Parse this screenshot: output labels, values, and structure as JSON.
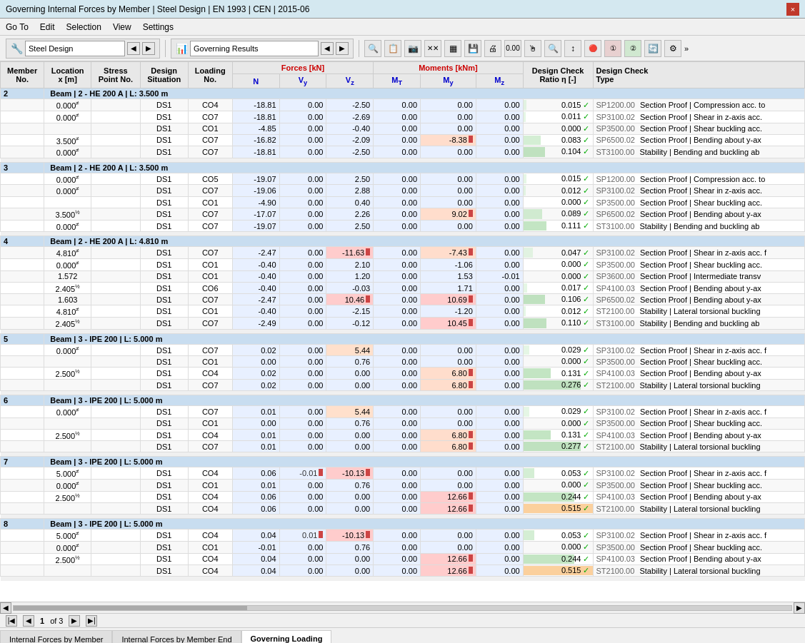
{
  "titleBar": {
    "title": "Governing Internal Forces by Member | Steel Design | EN 1993 | CEN | 2015-06",
    "closeLabel": "×"
  },
  "menuBar": {
    "items": [
      "Go To",
      "Edit",
      "Selection",
      "View",
      "Settings"
    ]
  },
  "toolbar": {
    "leftSection": {
      "icon": "🔧",
      "label": "Steel Design",
      "navPrev": "◀",
      "navNext": "▶"
    },
    "rightSection": {
      "icon": "📊",
      "label": "Governing Results",
      "navPrev": "◀",
      "navNext": "▶"
    },
    "icons": [
      "🔍",
      "📋",
      "📷",
      "✕✕",
      "▦",
      "💾",
      "🖨",
      "0.00",
      "🖱",
      "🔍",
      "↕",
      "🔴🔵",
      "①",
      "②",
      "🔄",
      "⚙"
    ]
  },
  "tableHeaders": {
    "row1": [
      "Member No.",
      "Location x [m]",
      "Stress Point No.",
      "Design Situation",
      "Loading No.",
      "Forces [kN]",
      "",
      "",
      "Moments [kNm]",
      "",
      "",
      "Design Check Ratio η [-]",
      "Design Check Type"
    ],
    "row2": [
      "",
      "",
      "",
      "",
      "",
      "N",
      "Vy",
      "Vz",
      "MT",
      "My",
      "Mz",
      "",
      ""
    ]
  },
  "members": [
    {
      "id": 2,
      "description": "Beam | 2 - HE 200 A | L: 3.500 m",
      "rows": [
        {
          "location": "0.000",
          "stressPoint": "≠",
          "situation": "DS1",
          "loading": "CO4",
          "N": "-18.81",
          "Vy": "0.00",
          "Vz": "-2.50",
          "MT": "0.00",
          "My": "0.00",
          "Mz": "0.00",
          "ratio": "0.015",
          "ratioCheck": "✓",
          "spCode": "SP1200.00",
          "designCheck": "Section Proof | Compression acc. to"
        },
        {
          "location": "0.000",
          "stressPoint": "≠",
          "situation": "DS1",
          "loading": "CO7",
          "N": "-18.81",
          "Vy": "0.00",
          "Vz": "-2.69",
          "MT": "0.00",
          "My": "0.00",
          "Mz": "0.00",
          "ratio": "0.011",
          "ratioCheck": "✓",
          "spCode": "SP3100.02",
          "designCheck": "Section Proof | Shear in z-axis acc."
        },
        {
          "location": "",
          "stressPoint": "",
          "situation": "DS1",
          "loading": "CO1",
          "N": "-4.85",
          "Vy": "0.00",
          "Vz": "-0.40",
          "MT": "0.00",
          "My": "0.00",
          "Mz": "0.00",
          "ratio": "0.000",
          "ratioCheck": "✓",
          "spCode": "SP3500.00",
          "designCheck": "Section Proof | Shear buckling acc."
        },
        {
          "location": "3.500",
          "stressPoint": "≠",
          "situation": "DS1",
          "loading": "CO7",
          "N": "-16.82",
          "Vy": "0.00",
          "Vz": "-2.09",
          "MT": "0.00",
          "My": "-8.38",
          "Mz": "0.00",
          "ratio": "0.083",
          "ratioCheck": "✓",
          "spCode": "SP6500.02",
          "designCheck": "Section Proof | Bending about y-ax"
        },
        {
          "location": "0.000",
          "stressPoint": "≠",
          "situation": "DS1",
          "loading": "CO7",
          "N": "-18.81",
          "Vy": "0.00",
          "Vz": "-2.50",
          "MT": "0.00",
          "My": "0.00",
          "Mz": "0.00",
          "ratio": "0.104",
          "ratioCheck": "✓",
          "spCode": "ST3100.00",
          "designCheck": "Stability | Bending and buckling ab"
        }
      ]
    },
    {
      "id": 3,
      "description": "Beam | 2 - HE 200 A | L: 3.500 m",
      "rows": [
        {
          "location": "0.000",
          "stressPoint": "≠",
          "situation": "DS1",
          "loading": "CO5",
          "N": "-19.07",
          "Vy": "0.00",
          "Vz": "2.50",
          "MT": "0.00",
          "My": "0.00",
          "Mz": "0.00",
          "ratio": "0.015",
          "ratioCheck": "✓",
          "spCode": "SP1200.00",
          "designCheck": "Section Proof | Compression acc. to"
        },
        {
          "location": "0.000",
          "stressPoint": "≠",
          "situation": "DS1",
          "loading": "CO7",
          "N": "-19.06",
          "Vy": "0.00",
          "Vz": "2.88",
          "MT": "0.00",
          "My": "0.00",
          "Mz": "0.00",
          "ratio": "0.012",
          "ratioCheck": "✓",
          "spCode": "SP3100.02",
          "designCheck": "Section Proof | Shear in z-axis acc."
        },
        {
          "location": "",
          "stressPoint": "",
          "situation": "DS1",
          "loading": "CO1",
          "N": "-4.90",
          "Vy": "0.00",
          "Vz": "0.40",
          "MT": "0.00",
          "My": "0.00",
          "Mz": "0.00",
          "ratio": "0.000",
          "ratioCheck": "✓",
          "spCode": "SP3500.00",
          "designCheck": "Section Proof | Shear buckling acc."
        },
        {
          "location": "3.500",
          "stressPoint": "½",
          "situation": "DS1",
          "loading": "CO7",
          "N": "-17.07",
          "Vy": "0.00",
          "Vz": "2.26",
          "MT": "0.00",
          "My": "9.02",
          "Mz": "0.00",
          "ratio": "0.089",
          "ratioCheck": "✓",
          "spCode": "SP6500.02",
          "designCheck": "Section Proof | Bending about y-ax"
        },
        {
          "location": "0.000",
          "stressPoint": "≠",
          "situation": "DS1",
          "loading": "CO7",
          "N": "-19.07",
          "Vy": "0.00",
          "Vz": "2.50",
          "MT": "0.00",
          "My": "0.00",
          "Mz": "0.00",
          "ratio": "0.111",
          "ratioCheck": "✓",
          "spCode": "ST3100.00",
          "designCheck": "Stability | Bending and buckling ab"
        }
      ]
    },
    {
      "id": 4,
      "description": "Beam | 2 - HE 200 A | L: 4.810 m",
      "rows": [
        {
          "location": "4.810",
          "stressPoint": "≠",
          "situation": "DS1",
          "loading": "CO7",
          "N": "-2.47",
          "Vy": "0.00",
          "Vz": "-11.63",
          "MT": "0.00",
          "My": "-7.43",
          "Mz": "0.00",
          "ratio": "0.047",
          "ratioCheck": "✓",
          "spCode": "SP3100.02",
          "designCheck": "Section Proof | Shear in z-axis acc. f"
        },
        {
          "location": "0.000",
          "stressPoint": "≠",
          "situation": "DS1",
          "loading": "CO1",
          "N": "-0.40",
          "Vy": "0.00",
          "Vz": "2.10",
          "MT": "0.00",
          "My": "-1.06",
          "Mz": "0.00",
          "ratio": "0.000",
          "ratioCheck": "✓",
          "spCode": "SP3500.00",
          "designCheck": "Section Proof | Shear buckling acc."
        },
        {
          "location": "1.572",
          "stressPoint": "",
          "situation": "DS1",
          "loading": "CO1",
          "N": "-0.40",
          "Vy": "0.00",
          "Vz": "1.20",
          "MT": "0.00",
          "My": "1.53",
          "Mz": "-0.01",
          "ratio": "0.000",
          "ratioCheck": "✓",
          "spCode": "SP3600.00",
          "designCheck": "Section Proof | Intermediate transv"
        },
        {
          "location": "2.405",
          "stressPoint": "½",
          "situation": "DS1",
          "loading": "CO6",
          "N": "-0.40",
          "Vy": "0.00",
          "Vz": "-0.03",
          "MT": "0.00",
          "My": "1.71",
          "Mz": "0.00",
          "ratio": "0.017",
          "ratioCheck": "✓",
          "spCode": "SP4100.03",
          "designCheck": "Section Proof | Bending about y-ax"
        },
        {
          "location": "1.603",
          "stressPoint": "",
          "situation": "DS1",
          "loading": "CO7",
          "N": "-2.47",
          "Vy": "0.00",
          "Vz": "10.46",
          "MT": "0.00",
          "My": "10.69",
          "Mz": "0.00",
          "ratio": "0.106",
          "ratioCheck": "✓",
          "spCode": "SP6500.02",
          "designCheck": "Section Proof | Bending about y-ax"
        },
        {
          "location": "4.810",
          "stressPoint": "≠",
          "situation": "DS1",
          "loading": "CO1",
          "N": "-0.40",
          "Vy": "0.00",
          "Vz": "-2.15",
          "MT": "0.00",
          "My": "-1.20",
          "Mz": "0.00",
          "ratio": "0.012",
          "ratioCheck": "✓",
          "spCode": "ST2100.00",
          "designCheck": "Stability | Lateral torsional buckling"
        },
        {
          "location": "2.405",
          "stressPoint": "½",
          "situation": "DS1",
          "loading": "CO7",
          "N": "-2.49",
          "Vy": "0.00",
          "Vz": "-0.12",
          "MT": "0.00",
          "My": "10.45",
          "Mz": "0.00",
          "ratio": "0.110",
          "ratioCheck": "✓",
          "spCode": "ST3100.00",
          "designCheck": "Stability | Bending and buckling ab"
        }
      ]
    },
    {
      "id": 5,
      "description": "Beam | 3 - IPE 200 | L: 5.000 m",
      "rows": [
        {
          "location": "0.000",
          "stressPoint": "≠",
          "situation": "DS1",
          "loading": "CO7",
          "N": "0.02",
          "Vy": "0.00",
          "Vz": "5.44",
          "MT": "0.00",
          "My": "0.00",
          "Mz": "0.00",
          "ratio": "0.029",
          "ratioCheck": "✓",
          "spCode": "SP3100.02",
          "designCheck": "Section Proof | Shear in z-axis acc. f"
        },
        {
          "location": "",
          "stressPoint": "",
          "situation": "DS1",
          "loading": "CO1",
          "N": "0.00",
          "Vy": "0.00",
          "Vz": "0.76",
          "MT": "0.00",
          "My": "0.00",
          "Mz": "0.00",
          "ratio": "0.000",
          "ratioCheck": "✓",
          "spCode": "SP3500.00",
          "designCheck": "Section Proof | Shear buckling acc."
        },
        {
          "location": "2.500",
          "stressPoint": "½",
          "situation": "DS1",
          "loading": "CO4",
          "N": "0.02",
          "Vy": "0.00",
          "Vz": "0.00",
          "MT": "0.00",
          "My": "6.80",
          "Mz": "0.00",
          "ratio": "0.131",
          "ratioCheck": "✓",
          "spCode": "SP4100.03",
          "designCheck": "Section Proof | Bending about y-ax"
        },
        {
          "location": "",
          "stressPoint": "",
          "situation": "DS1",
          "loading": "CO7",
          "N": "0.02",
          "Vy": "0.00",
          "Vz": "0.00",
          "MT": "0.00",
          "My": "6.80",
          "Mz": "0.00",
          "ratio": "0.276",
          "ratioCheck": "✓",
          "spCode": "ST2100.00",
          "designCheck": "Stability | Lateral torsional buckling"
        }
      ]
    },
    {
      "id": 6,
      "description": "Beam | 3 - IPE 200 | L: 5.000 m",
      "rows": [
        {
          "location": "0.000",
          "stressPoint": "≠",
          "situation": "DS1",
          "loading": "CO7",
          "N": "0.01",
          "Vy": "0.00",
          "Vz": "5.44",
          "MT": "0.00",
          "My": "0.00",
          "Mz": "0.00",
          "ratio": "0.029",
          "ratioCheck": "✓",
          "spCode": "SP3100.02",
          "designCheck": "Section Proof | Shear in z-axis acc. f"
        },
        {
          "location": "",
          "stressPoint": "",
          "situation": "DS1",
          "loading": "CO1",
          "N": "0.00",
          "Vy": "0.00",
          "Vz": "0.76",
          "MT": "0.00",
          "My": "0.00",
          "Mz": "0.00",
          "ratio": "0.000",
          "ratioCheck": "✓",
          "spCode": "SP3500.00",
          "designCheck": "Section Proof | Shear buckling acc."
        },
        {
          "location": "2.500",
          "stressPoint": "½",
          "situation": "DS1",
          "loading": "CO4",
          "N": "0.01",
          "Vy": "0.00",
          "Vz": "0.00",
          "MT": "0.00",
          "My": "6.80",
          "Mz": "0.00",
          "ratio": "0.131",
          "ratioCheck": "✓",
          "spCode": "SP4100.03",
          "designCheck": "Section Proof | Bending about y-ax"
        },
        {
          "location": "",
          "stressPoint": "",
          "situation": "DS1",
          "loading": "CO7",
          "N": "0.01",
          "Vy": "0.00",
          "Vz": "0.00",
          "MT": "0.00",
          "My": "6.80",
          "Mz": "0.00",
          "ratio": "0.277",
          "ratioCheck": "✓",
          "spCode": "ST2100.00",
          "designCheck": "Stability | Lateral torsional buckling"
        }
      ]
    },
    {
      "id": 7,
      "description": "Beam | 3 - IPE 200 | L: 5.000 m",
      "rows": [
        {
          "location": "5.000",
          "stressPoint": "≠",
          "situation": "DS1",
          "loading": "CO4",
          "N": "0.06",
          "Vy": "-0.01",
          "Vz": "-10.13",
          "MT": "0.00",
          "My": "0.00",
          "Mz": "0.00",
          "ratio": "0.053",
          "ratioCheck": "✓",
          "spCode": "SP3100.02",
          "designCheck": "Section Proof | Shear in z-axis acc. f"
        },
        {
          "location": "0.000",
          "stressPoint": "≠",
          "situation": "DS1",
          "loading": "CO1",
          "N": "0.01",
          "Vy": "0.00",
          "Vz": "0.76",
          "MT": "0.00",
          "My": "0.00",
          "Mz": "0.00",
          "ratio": "0.000",
          "ratioCheck": "✓",
          "spCode": "SP3500.00",
          "designCheck": "Section Proof | Shear buckling acc."
        },
        {
          "location": "2.500",
          "stressPoint": "½",
          "situation": "DS1",
          "loading": "CO4",
          "N": "0.06",
          "Vy": "0.00",
          "Vz": "0.00",
          "MT": "0.00",
          "My": "12.66",
          "Mz": "0.00",
          "ratio": "0.244",
          "ratioCheck": "✓",
          "spCode": "SP4100.03",
          "designCheck": "Section Proof | Bending about y-ax"
        },
        {
          "location": "",
          "stressPoint": "",
          "situation": "DS1",
          "loading": "CO4",
          "N": "0.06",
          "Vy": "0.00",
          "Vz": "0.00",
          "MT": "0.00",
          "My": "12.66",
          "Mz": "0.00",
          "ratio": "0.515",
          "ratioCheck": "✓",
          "spCode": "ST2100.00",
          "designCheck": "Stability | Lateral torsional buckling"
        }
      ]
    },
    {
      "id": 8,
      "description": "Beam | 3 - IPE 200 | L: 5.000 m",
      "rows": [
        {
          "location": "5.000",
          "stressPoint": "≠",
          "situation": "DS1",
          "loading": "CO4",
          "N": "0.04",
          "Vy": "0.01",
          "Vz": "-10.13",
          "MT": "0.00",
          "My": "0.00",
          "Mz": "0.00",
          "ratio": "0.053",
          "ratioCheck": "✓",
          "spCode": "SP3100.02",
          "designCheck": "Section Proof | Shear in z-axis acc. f"
        },
        {
          "location": "0.000",
          "stressPoint": "≠",
          "situation": "DS1",
          "loading": "CO1",
          "N": "-0.01",
          "Vy": "0.00",
          "Vz": "0.76",
          "MT": "0.00",
          "My": "0.00",
          "Mz": "0.00",
          "ratio": "0.000",
          "ratioCheck": "✓",
          "spCode": "SP3500.00",
          "designCheck": "Section Proof | Shear buckling acc."
        },
        {
          "location": "2.500",
          "stressPoint": "½",
          "situation": "DS1",
          "loading": "CO4",
          "N": "0.04",
          "Vy": "0.00",
          "Vz": "0.00",
          "MT": "0.00",
          "My": "12.66",
          "Mz": "0.00",
          "ratio": "0.244",
          "ratioCheck": "✓",
          "spCode": "SP4100.03",
          "designCheck": "Section Proof | Bending about y-ax"
        },
        {
          "location": "",
          "stressPoint": "",
          "situation": "DS1",
          "loading": "CO4",
          "N": "0.04",
          "Vy": "0.00",
          "Vz": "0.00",
          "MT": "0.00",
          "My": "12.66",
          "Mz": "0.00",
          "ratio": "0.515",
          "ratioCheck": "✓",
          "spCode": "ST2100.00",
          "designCheck": "Stability | Lateral torsional buckling"
        }
      ]
    }
  ],
  "statusBar": {
    "page": "1",
    "totalPages": "3",
    "pageLabel": "of 3"
  },
  "tabs": [
    {
      "label": "Internal Forces by Member",
      "active": false
    },
    {
      "label": "Internal Forces by Member End",
      "active": false
    },
    {
      "label": "Governing Loading",
      "active": true
    }
  ]
}
